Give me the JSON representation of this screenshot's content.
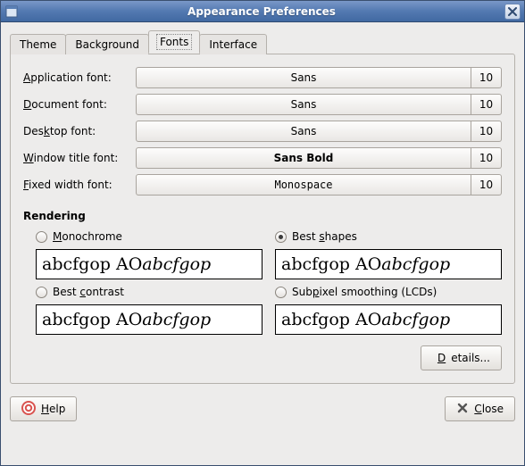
{
  "window": {
    "title": "Appearance Preferences"
  },
  "tabs": {
    "theme": "Theme",
    "background": "Background",
    "fonts": "Fonts",
    "interface": "Interface",
    "active": "fonts"
  },
  "font_rows": {
    "application": {
      "label_pre": "",
      "label_ul": "A",
      "label_post": "pplication font:",
      "name": "Sans",
      "size": "10"
    },
    "document": {
      "label_pre": "",
      "label_ul": "D",
      "label_post": "ocument font:",
      "name": "Sans",
      "size": "10"
    },
    "desktop": {
      "label_pre": "Des",
      "label_ul": "k",
      "label_post": "top font:",
      "name": "Sans",
      "size": "10"
    },
    "windowtitle": {
      "label_pre": "",
      "label_ul": "W",
      "label_post": "indow title font:",
      "name": "Sans Bold",
      "size": "10"
    },
    "fixedwidth": {
      "label_pre": "",
      "label_ul": "F",
      "label_post": "ixed width font:",
      "name": "Monospace",
      "size": "10"
    }
  },
  "rendering": {
    "title": "Rendering",
    "monochrome": {
      "pre": "",
      "ul": "M",
      "post": "onochrome",
      "checked": false
    },
    "bestshapes": {
      "pre": "Best ",
      "ul": "s",
      "post": "hapes",
      "checked": true
    },
    "bestcontrast": {
      "pre": "Best ",
      "ul": "c",
      "post": "ontrast",
      "checked": false
    },
    "subpixel": {
      "pre": "Sub",
      "ul": "p",
      "post": "ixel smoothing (LCDs)",
      "checked": false
    },
    "sample_regular": "abcfgop AO ",
    "sample_italic": "abcfgop"
  },
  "buttons": {
    "details_pre": "",
    "details_ul": "D",
    "details_post": "etails...",
    "help_pre": "",
    "help_ul": "H",
    "help_post": "elp",
    "close_pre": "",
    "close_ul": "C",
    "close_post": "lose"
  }
}
